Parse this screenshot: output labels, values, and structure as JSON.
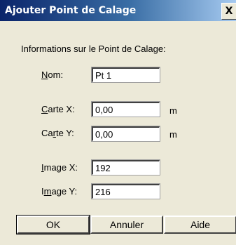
{
  "window": {
    "title": "Ajouter Point de Calage",
    "close_glyph": "X"
  },
  "form": {
    "header": "Informations sur le Point de Calage:",
    "fields": [
      {
        "key": "N",
        "rest": "om:",
        "value": "Pt 1",
        "unit": ""
      },
      {
        "key": "C",
        "rest": "arte X:",
        "value": "0,00",
        "unit": "m"
      },
      {
        "key_prefix": "Ca",
        "key": "r",
        "rest": "te Y:",
        "value": "0,00",
        "unit": "m"
      },
      {
        "key": "I",
        "rest": "mage X:",
        "value": "192",
        "unit": ""
      },
      {
        "key_prefix": "I",
        "key": "m",
        "rest": "age Y:",
        "value": "216",
        "unit": ""
      }
    ]
  },
  "buttons": {
    "ok": "OK",
    "cancel": "Annuler",
    "help": "Aide"
  }
}
